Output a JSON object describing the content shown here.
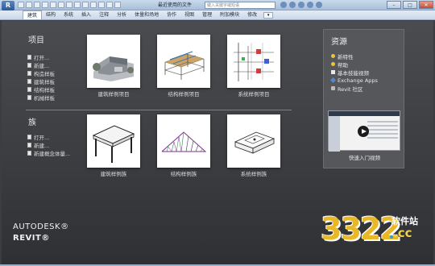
{
  "titlebar": {
    "app_button": "R",
    "document_title": "最近使用的文件",
    "search_placeholder": "键入关键字或短语",
    "min": "–",
    "max": "□",
    "close": "✕"
  },
  "ribbon": {
    "tabs": [
      "建筑",
      "结构",
      "系统",
      "插入",
      "注释",
      "分析",
      "体量和场地",
      "协作",
      "视图",
      "管理",
      "附加模块",
      "修改"
    ],
    "active_tab": "建筑",
    "extra": "▾"
  },
  "projects": {
    "title": "项目",
    "links": [
      "打开...",
      "新建...",
      "构造样板",
      "建筑样板",
      "结构样板",
      "机械样板"
    ],
    "thumbnails": [
      "建筑样例项目",
      "结构样例项目",
      "系统样例项目"
    ]
  },
  "families": {
    "title": "族",
    "links": [
      "打开...",
      "新建...",
      "新建概念体量..."
    ],
    "thumbnails": [
      "建筑样例族",
      "结构样例族",
      "系统样例族"
    ]
  },
  "resources": {
    "title": "资源",
    "items": [
      {
        "label": "新特性",
        "icon": "bulb-icon"
      },
      {
        "label": "帮助",
        "icon": "help-icon"
      },
      {
        "label": "基本技能视频",
        "icon": "video-icon"
      },
      {
        "label": "Exchange Apps",
        "icon": "exchange-icon"
      },
      {
        "label": "Revit 社区",
        "icon": "community-icon"
      }
    ],
    "video_label": "快速入门视频"
  },
  "brand": {
    "company": "AUTODESK®",
    "product": "REVIT®"
  },
  "watermark": {
    "number": "3322",
    "cn": "软件站",
    "domain": ".cc"
  },
  "colors": {
    "background": "#3b3d40",
    "panel": "#55575b",
    "watermark_yellow": "#e9b829"
  }
}
